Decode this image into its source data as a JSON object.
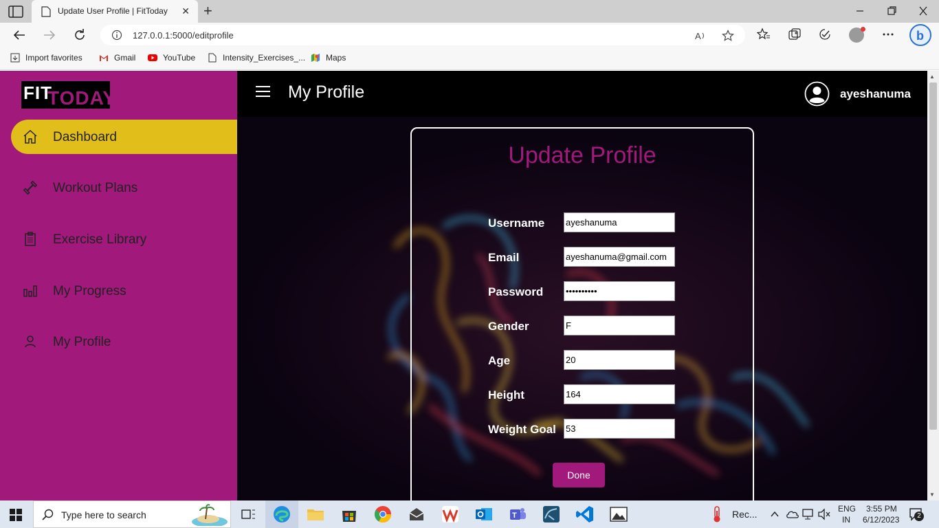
{
  "browser": {
    "tab_title": "Update User Profile | FitToday",
    "tab_close": "✕",
    "new_tab": "+",
    "url": "127.0.0.1:5000/editprofile",
    "favorites": [
      "Import favorites",
      "Gmail",
      "YouTube",
      "Intensity_Exercises_...",
      "Maps"
    ]
  },
  "app": {
    "logo_fit": "FIT",
    "logo_today": "TODAY",
    "nav": [
      {
        "label": "Dashboard",
        "icon": "home-icon",
        "active": true
      },
      {
        "label": "Workout Plans",
        "icon": "dumbbell-icon",
        "active": false
      },
      {
        "label": "Exercise Library",
        "icon": "clipboard-icon",
        "active": false
      },
      {
        "label": "My Progress",
        "icon": "bar-chart-icon",
        "active": false
      },
      {
        "label": "My Profile",
        "icon": "user-icon",
        "active": false
      }
    ],
    "page_title": "My Profile",
    "username": "ayeshanuma"
  },
  "form": {
    "title": "Update Profile",
    "fields": [
      {
        "label": "Username",
        "value": "ayeshanuma"
      },
      {
        "label": "Email",
        "value": "ayeshanuma@gmail.com"
      },
      {
        "label": "Password",
        "value": "••••••••••"
      },
      {
        "label": "Gender",
        "value": "F"
      },
      {
        "label": "Age",
        "value": "20"
      },
      {
        "label": "Height",
        "value": "164"
      },
      {
        "label": "Weight Goal",
        "value": "53"
      }
    ],
    "submit_label": "Done"
  },
  "taskbar": {
    "search_placeholder": "Type here to search",
    "weather_text": "Rec...",
    "lang_top": "ENG",
    "lang_bottom": "IN",
    "time": "3:55 PM",
    "date": "6/12/2023",
    "notification_count": "2"
  },
  "colors": {
    "brand": "#a1197b",
    "active_nav": "#e2be1b",
    "topbar": "#000000"
  }
}
